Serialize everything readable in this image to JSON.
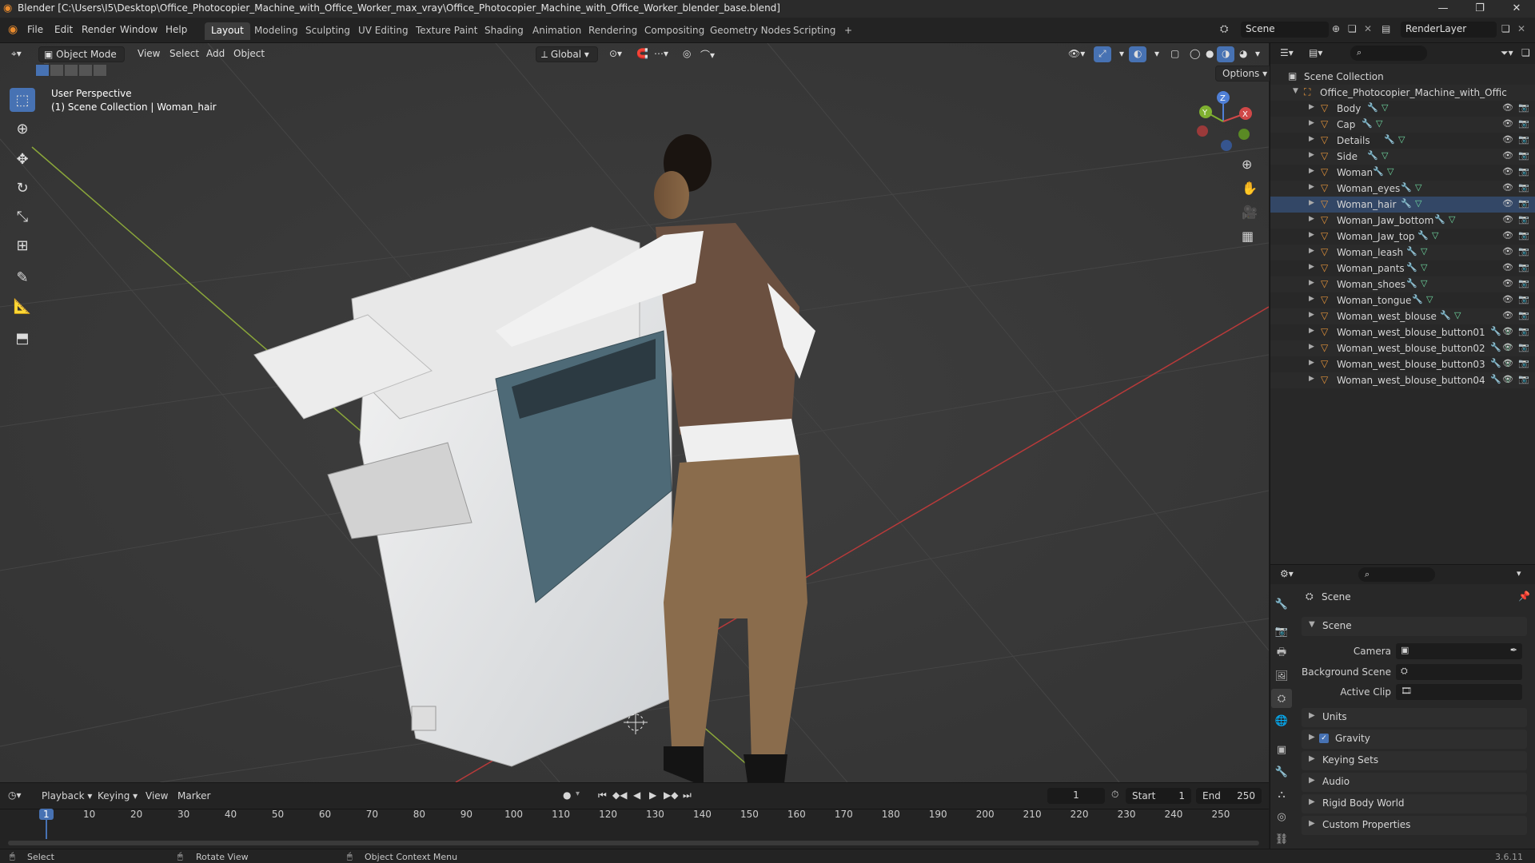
{
  "window": {
    "title": "Blender [C:\\Users\\I5\\Desktop\\Office_Photocopier_Machine_with_Office_Worker_max_vray\\Office_Photocopier_Machine_with_Office_Worker_blender_base.blend]",
    "minimize": "—",
    "maximize": "❐",
    "close": "✕"
  },
  "menu": [
    "File",
    "Edit",
    "Render",
    "Window",
    "Help"
  ],
  "workspaces": [
    "Layout",
    "Modeling",
    "Sculpting",
    "UV Editing",
    "Texture Paint",
    "Shading",
    "Animation",
    "Rendering",
    "Compositing",
    "Geometry Nodes",
    "Scripting"
  ],
  "active_workspace": "Layout",
  "add_workspace": "+",
  "scene_field": "Scene",
  "render_layer_field": "RenderLayer",
  "viewport": {
    "mode": "Object Mode",
    "menus": [
      "View",
      "Select",
      "Add",
      "Object"
    ],
    "transform_orientation": "Global",
    "options_label": "Options",
    "info_line1": "User Perspective",
    "info_line2": "(1) Scene Collection | Woman_hair",
    "gizmo_x": "X",
    "gizmo_y": "Y",
    "gizmo_z": "Z"
  },
  "outliner": {
    "root": "Scene Collection",
    "collection": "Office_Photocopier_Machine_with_Offic",
    "objects": [
      {
        "name": "Body"
      },
      {
        "name": "Cap"
      },
      {
        "name": "Details"
      },
      {
        "name": "Side"
      },
      {
        "name": "Woman"
      },
      {
        "name": "Woman_eyes"
      },
      {
        "name": "Woman_hair"
      },
      {
        "name": "Woman_Jaw_bottom"
      },
      {
        "name": "Woman_Jaw_top"
      },
      {
        "name": "Woman_leash"
      },
      {
        "name": "Woman_pants"
      },
      {
        "name": "Woman_shoes"
      },
      {
        "name": "Woman_tongue"
      },
      {
        "name": "Woman_west_blouse"
      },
      {
        "name": "Woman_west_blouse_button01"
      },
      {
        "name": "Woman_west_blouse_button02"
      },
      {
        "name": "Woman_west_blouse_button03"
      },
      {
        "name": "Woman_west_blouse_button04"
      }
    ]
  },
  "properties": {
    "header": "Scene",
    "section_scene": "Scene",
    "camera_label": "Camera",
    "background_scene_label": "Background Scene",
    "active_clip_label": "Active Clip",
    "sections": [
      "Units",
      "Gravity",
      "Keying Sets",
      "Audio",
      "Rigid Body World",
      "Custom Properties"
    ],
    "gravity_checked": true
  },
  "timeline": {
    "menus": [
      "Playback",
      "Keying",
      "View",
      "Marker"
    ],
    "current_frame": "1",
    "start_label": "Start",
    "start_value": "1",
    "end_label": "End",
    "end_value": "250",
    "ruler": [
      "1",
      "10",
      "20",
      "30",
      "40",
      "50",
      "60",
      "70",
      "80",
      "90",
      "100",
      "110",
      "120",
      "130",
      "140",
      "150",
      "160",
      "170",
      "180",
      "190",
      "200",
      "210",
      "220",
      "230",
      "240",
      "250"
    ]
  },
  "statusbar": {
    "select": "Select",
    "rotate": "Rotate View",
    "context": "Object Context Menu",
    "version": "3.6.11"
  },
  "colors": {
    "accent": "#4772b3",
    "object_icon": "#e3933a",
    "playhead": "#4772b3"
  }
}
